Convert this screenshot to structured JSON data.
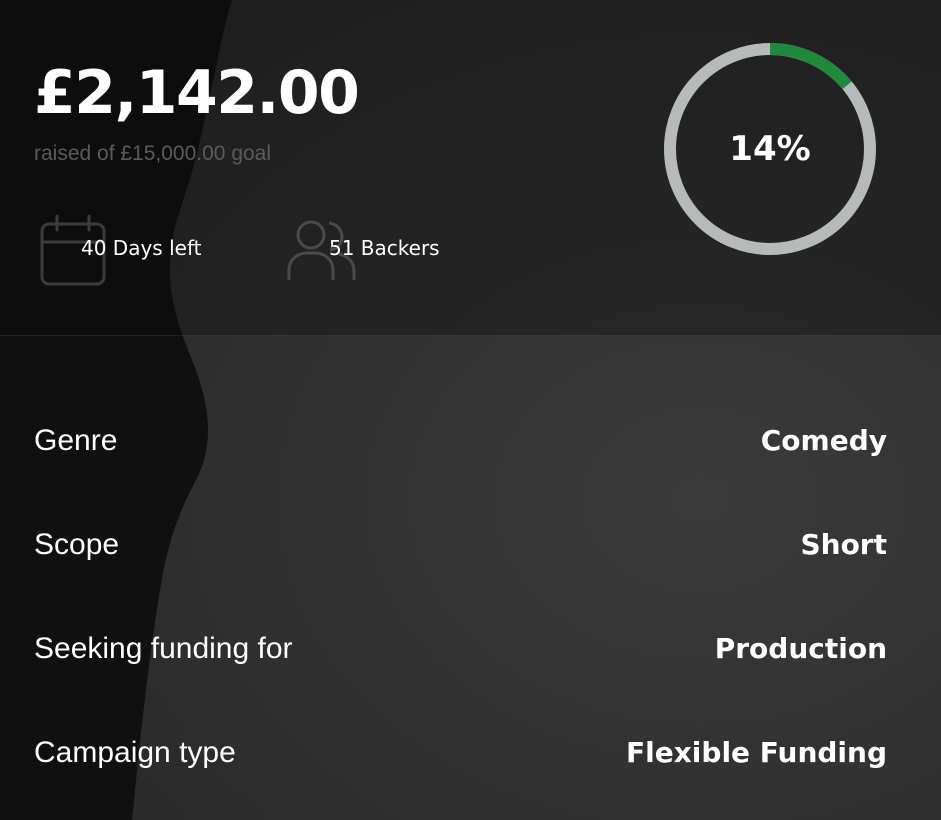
{
  "funding": {
    "raised_amount": "£2,142.00",
    "goal_text": "raised of £15,000.00 goal",
    "progress_percent": 14,
    "progress_label": "14%"
  },
  "stats": {
    "days_left": "40 Days left",
    "backers": "51 Backers"
  },
  "details": [
    {
      "key": "Genre",
      "value": "Comedy"
    },
    {
      "key": "Scope",
      "value": "Short"
    },
    {
      "key": "Seeking funding for",
      "value": "Production"
    },
    {
      "key": "Campaign type",
      "value": "Flexible Funding"
    }
  ],
  "icons": {
    "days": "calendar-icon",
    "backers": "users-icon"
  },
  "colors": {
    "progress": "#1f8a3b",
    "track": "#b7babb"
  }
}
